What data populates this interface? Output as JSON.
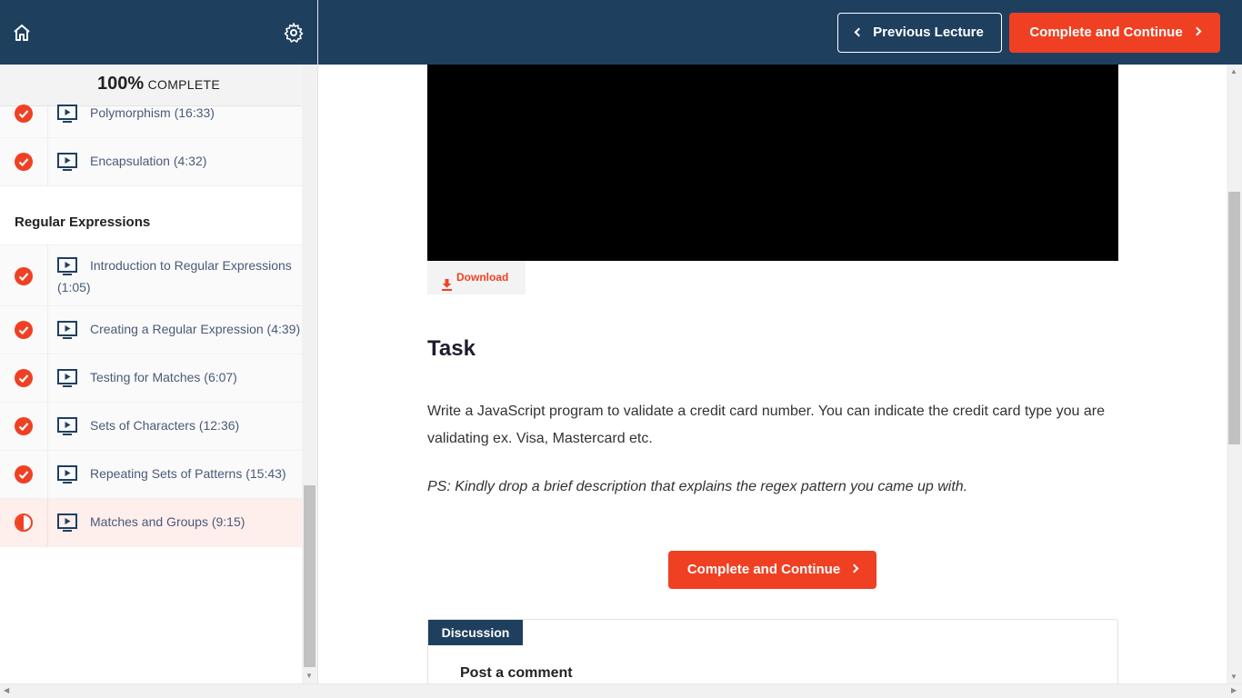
{
  "sidebar": {
    "progress_pct": "100%",
    "progress_label": "COMPLETE",
    "section_title": "Regular Expressions",
    "items": [
      {
        "title": "Polymorphism (16:33)",
        "status": "complete"
      },
      {
        "title": "Encapsulation (4:32)",
        "status": "complete"
      },
      {
        "title": "Introduction to Regular Expressions",
        "title_line2": "(1:05)",
        "status": "complete"
      },
      {
        "title": "Creating a Regular Expression (4:39)",
        "status": "complete"
      },
      {
        "title": "Testing for Matches (6:07)",
        "status": "complete"
      },
      {
        "title": "Sets of Characters (12:36)",
        "status": "complete"
      },
      {
        "title": "Repeating Sets of Patterns (15:43)",
        "status": "complete"
      },
      {
        "title": "Matches and Groups (9:15)",
        "status": "in-progress"
      }
    ]
  },
  "topbar": {
    "prev_label": "Previous Lecture",
    "next_label": "Complete and Continue"
  },
  "main": {
    "download_label": "Download",
    "task_heading": "Task",
    "task_text": "Write a JavaScript program to validate a credit card number. You can indicate the credit card type you are validating ex. Visa, Mastercard etc.",
    "task_ps": "PS: Kindly drop a brief description that explains the regex pattern you came up with.",
    "complete_label": "Complete and Continue",
    "discussion_tab": "Discussion",
    "post_comment": "Post a comment"
  },
  "colors": {
    "nav": "#1f3f5f",
    "accent": "#f04023"
  }
}
